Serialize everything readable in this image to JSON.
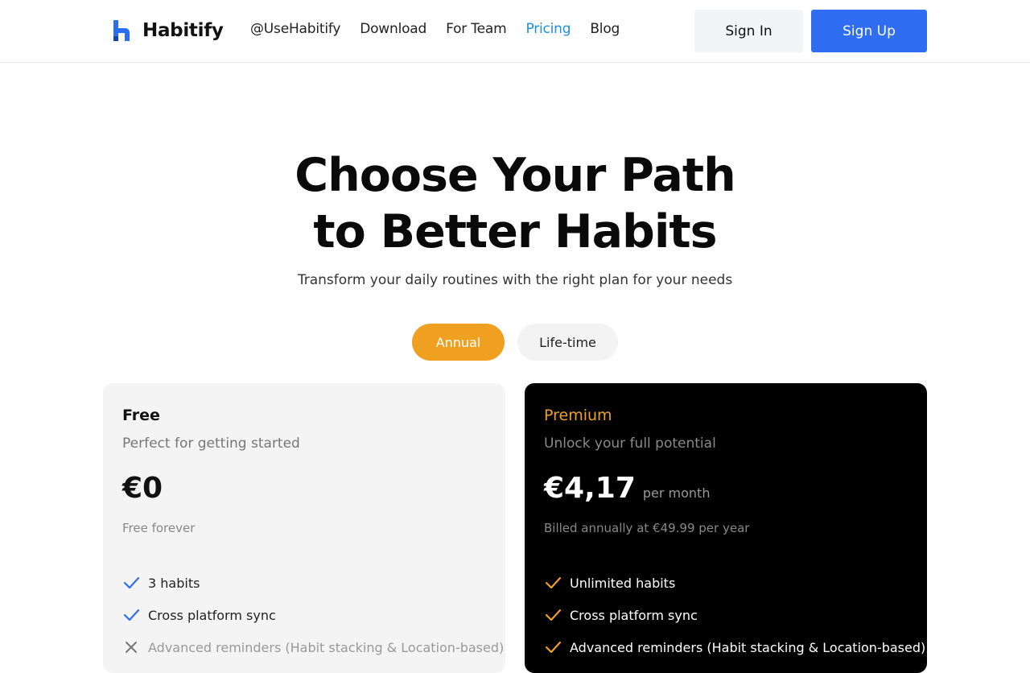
{
  "brand": {
    "name": "Habitify"
  },
  "nav": {
    "items": [
      {
        "label": "@UseHabitify",
        "active": false
      },
      {
        "label": "Download",
        "active": false
      },
      {
        "label": "For Team",
        "active": false
      },
      {
        "label": "Pricing",
        "active": true
      },
      {
        "label": "Blog",
        "active": false
      }
    ],
    "sign_in": "Sign In",
    "sign_up": "Sign Up"
  },
  "hero": {
    "title_line1": "Choose Your Path",
    "title_line2": "to Better Habits",
    "subtitle": "Transform your daily routines with the right plan for your needs"
  },
  "billing_toggle": {
    "options": [
      "Annual",
      "Life-time"
    ],
    "selected": "Annual"
  },
  "plans": [
    {
      "name": "Free",
      "description": "Perfect for getting started",
      "price": "€0",
      "period": "",
      "billing_note": "Free forever",
      "features": [
        {
          "text": "3 habits",
          "included": true
        },
        {
          "text": "Cross platform sync",
          "included": true
        },
        {
          "text": "Advanced reminders (Habit stacking & Location-based)",
          "included": false
        }
      ]
    },
    {
      "name": "Premium",
      "description": "Unlock your full potential",
      "price": "€4,17",
      "period": "per month",
      "billing_note": "Billed annually at €49.99 per year",
      "features": [
        {
          "text": "Unlimited habits",
          "included": true
        },
        {
          "text": "Cross platform sync",
          "included": true
        },
        {
          "text": "Advanced reminders (Habit stacking & Location-based)",
          "included": true
        }
      ]
    }
  ],
  "colors": {
    "accent_orange": "#f0a020",
    "primary_blue": "#2f6ef2",
    "nav_active": "#1e8fe0"
  }
}
